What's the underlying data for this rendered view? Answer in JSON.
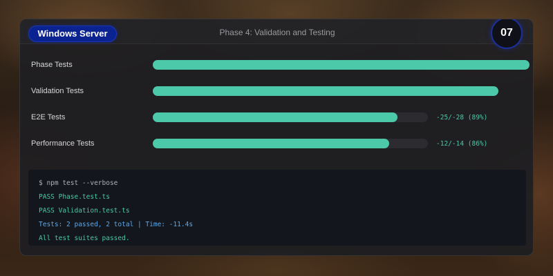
{
  "header": {
    "os_badge": "Windows Server",
    "phase_title": "Phase 4: Validation and Testing",
    "step_number": "07"
  },
  "tests": [
    {
      "label": "Phase Tests",
      "progress": 1.09,
      "stat": ""
    },
    {
      "label": "Validation Tests",
      "progress": 1.0,
      "stat": ""
    },
    {
      "label": "E2E Tests",
      "progress": 0.89,
      "stat": "-25/-28 (89%)"
    },
    {
      "label": "Performance Tests",
      "progress": 0.86,
      "stat": "-12/-14 (86%)"
    }
  ],
  "terminal": {
    "lines": [
      {
        "text": "$ npm test --verbose",
        "kind": "cmd"
      },
      {
        "text": "PASS Phase.test.ts",
        "kind": "pass"
      },
      {
        "text": "PASS Validation.test.ts",
        "kind": "pass"
      },
      {
        "text": "Tests: 2 passed, 2 total | Time: -11.4s",
        "kind": "summary"
      },
      {
        "text": "All test suites passed.",
        "kind": "ok"
      }
    ]
  },
  "colors": {
    "accent": "#4cc9a8",
    "badge": "#0b2390",
    "summary": "#5fa8e8"
  }
}
